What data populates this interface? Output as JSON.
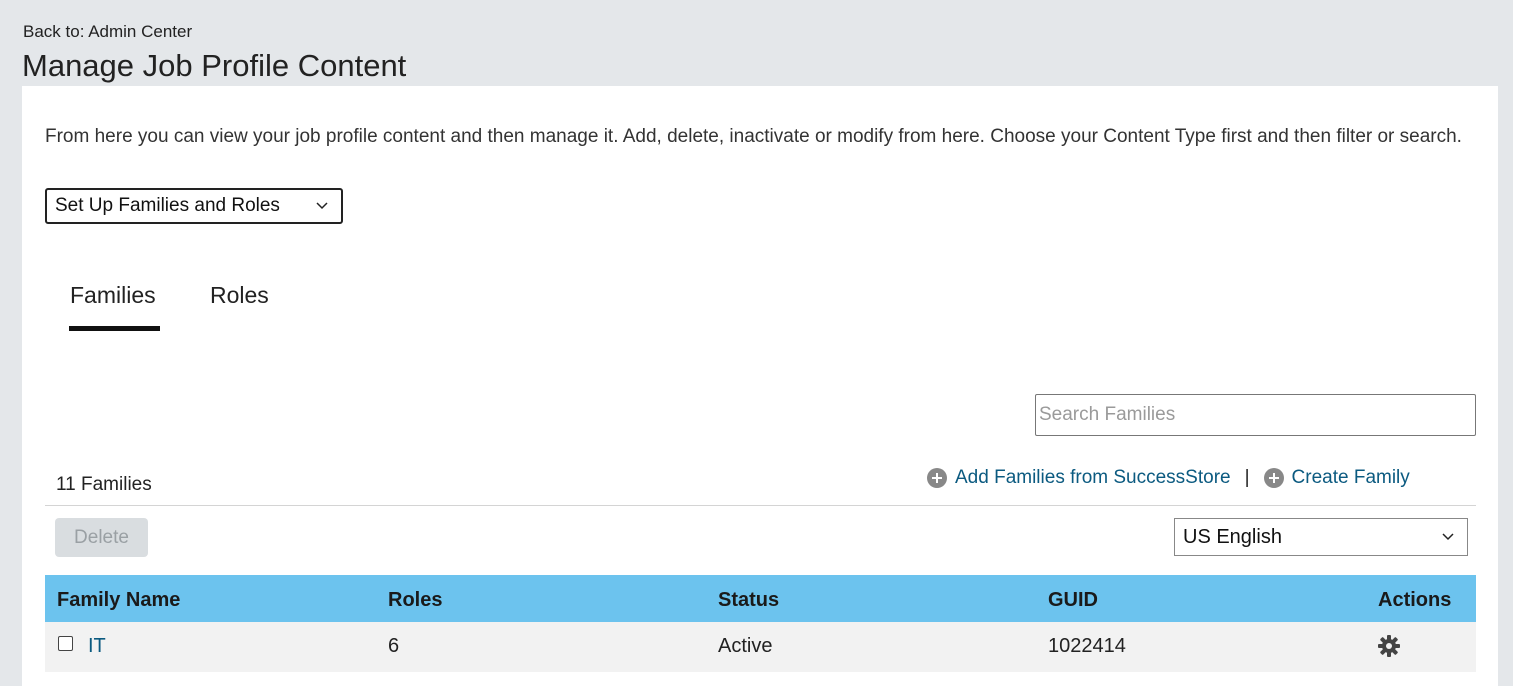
{
  "header": {
    "back_link": "Back to: Admin Center",
    "title": "Manage Job Profile Content"
  },
  "intro_text": "From here you can view your job profile content and then manage it. Add, delete, inactivate or modify from here. Choose your Content Type first and then filter or search.",
  "content_type": {
    "selected": "Set Up Families and Roles"
  },
  "tabs": [
    {
      "label": "Families",
      "active": true
    },
    {
      "label": "Roles",
      "active": false
    }
  ],
  "search": {
    "placeholder": "Search Families",
    "value": ""
  },
  "toolbar": {
    "count": "11 Families",
    "add_from_store": "Add Families from SuccessStore",
    "separator": "|",
    "create": "Create Family",
    "delete": "Delete",
    "language": "US English"
  },
  "table": {
    "columns": [
      "Family Name",
      "Roles",
      "Status",
      "GUID",
      "Actions"
    ],
    "rows": [
      {
        "family_name": "IT",
        "roles": "6",
        "status": "Active",
        "guid": "1022414"
      }
    ]
  },
  "icons": {
    "chevron": "chevron-down-icon",
    "add": "plus-circle-icon",
    "actions": "gear-icon"
  },
  "colors": {
    "header_bg": "#6cc3ee",
    "link": "#0b5a80",
    "page_bg": "#e4e7ea"
  }
}
